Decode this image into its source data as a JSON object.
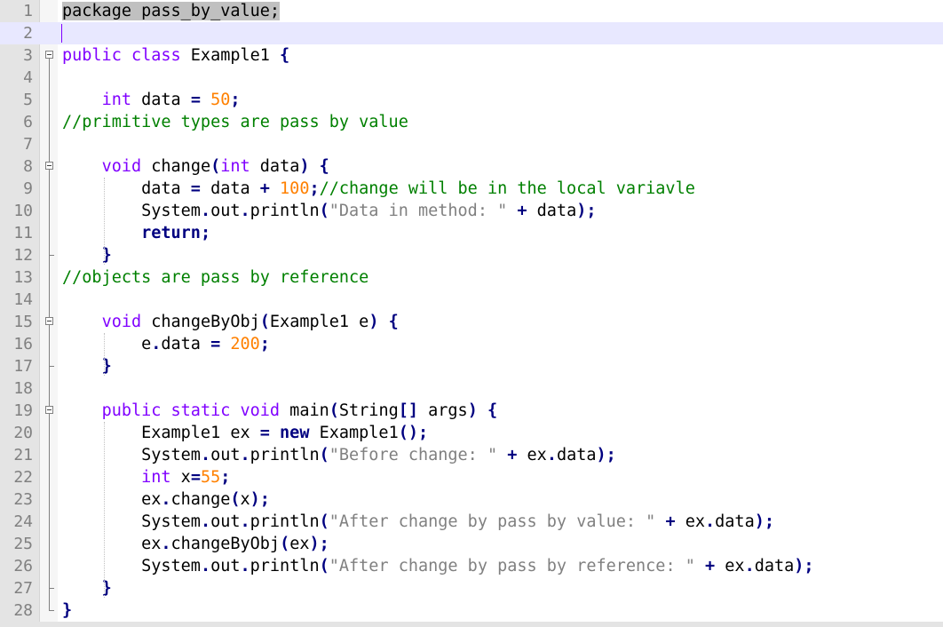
{
  "editor": {
    "current_line": 2,
    "lines": [
      {
        "number": "1",
        "tokens": [
          [
            "package pass_by_value;",
            "sel"
          ]
        ]
      },
      {
        "number": "2",
        "tokens": []
      },
      {
        "number": "3",
        "fold": "open",
        "tokens": [
          [
            "public class ",
            "kw"
          ],
          [
            "Example1 ",
            ""
          ],
          [
            "{",
            "op"
          ]
        ]
      },
      {
        "number": "4",
        "tokens": []
      },
      {
        "number": "5",
        "tokens": [
          [
            "    ",
            ""
          ],
          [
            "int",
            "kw"
          ],
          [
            " data ",
            ""
          ],
          [
            "=",
            "op"
          ],
          [
            " ",
            ""
          ],
          [
            "50",
            "num"
          ],
          [
            ";",
            "op"
          ]
        ]
      },
      {
        "number": "6",
        "tokens": [
          [
            "//primitive types are pass by value",
            "cmt"
          ]
        ]
      },
      {
        "number": "7",
        "tokens": []
      },
      {
        "number": "8",
        "fold": "open",
        "tokens": [
          [
            "    ",
            ""
          ],
          [
            "void",
            "kw"
          ],
          [
            " change",
            ""
          ],
          [
            "(",
            "op"
          ],
          [
            "int",
            "kw"
          ],
          [
            " data",
            ""
          ],
          [
            ")",
            "op"
          ],
          [
            " ",
            ""
          ],
          [
            "{",
            "op"
          ]
        ]
      },
      {
        "number": "9",
        "tokens": [
          [
            "        data ",
            ""
          ],
          [
            "=",
            "op"
          ],
          [
            " data ",
            ""
          ],
          [
            "+",
            "op"
          ],
          [
            " ",
            ""
          ],
          [
            "100",
            "num"
          ],
          [
            ";",
            "op"
          ],
          [
            "//change will be in the local variavle",
            "cmt"
          ]
        ]
      },
      {
        "number": "10",
        "tokens": [
          [
            "        System",
            ""
          ],
          [
            ".",
            "op"
          ],
          [
            "out",
            ""
          ],
          [
            ".",
            "op"
          ],
          [
            "println",
            ""
          ],
          [
            "(",
            "op"
          ],
          [
            "\"Data in method: \"",
            "str"
          ],
          [
            " ",
            ""
          ],
          [
            "+",
            "op"
          ],
          [
            " data",
            ""
          ],
          [
            ");",
            "op"
          ]
        ]
      },
      {
        "number": "11",
        "tokens": [
          [
            "        ",
            ""
          ],
          [
            "return",
            "kwb"
          ],
          [
            ";",
            "op"
          ]
        ]
      },
      {
        "number": "12",
        "fold": "end",
        "tokens": [
          [
            "    ",
            ""
          ],
          [
            "}",
            "op"
          ]
        ]
      },
      {
        "number": "13",
        "tokens": [
          [
            "//objects are pass by reference",
            "cmt"
          ]
        ]
      },
      {
        "number": "14",
        "tokens": []
      },
      {
        "number": "15",
        "fold": "open",
        "tokens": [
          [
            "    ",
            ""
          ],
          [
            "void",
            "kw"
          ],
          [
            " changeByObj",
            ""
          ],
          [
            "(",
            "op"
          ],
          [
            "Example1 e",
            ""
          ],
          [
            ")",
            "op"
          ],
          [
            " ",
            ""
          ],
          [
            "{",
            "op"
          ]
        ]
      },
      {
        "number": "16",
        "tokens": [
          [
            "        e",
            ""
          ],
          [
            ".",
            "op"
          ],
          [
            "data ",
            ""
          ],
          [
            "=",
            "op"
          ],
          [
            " ",
            ""
          ],
          [
            "200",
            "num"
          ],
          [
            ";",
            "op"
          ]
        ]
      },
      {
        "number": "17",
        "fold": "end",
        "tokens": [
          [
            "    ",
            ""
          ],
          [
            "}",
            "op"
          ]
        ]
      },
      {
        "number": "18",
        "tokens": []
      },
      {
        "number": "19",
        "fold": "open",
        "tokens": [
          [
            "    ",
            ""
          ],
          [
            "public static void",
            "kw"
          ],
          [
            " main",
            ""
          ],
          [
            "(",
            "op"
          ],
          [
            "String",
            ""
          ],
          [
            "[]",
            "op"
          ],
          [
            " args",
            ""
          ],
          [
            ")",
            "op"
          ],
          [
            " ",
            ""
          ],
          [
            "{",
            "op"
          ]
        ]
      },
      {
        "number": "20",
        "tokens": [
          [
            "        Example1 ex ",
            ""
          ],
          [
            "=",
            "op"
          ],
          [
            " ",
            ""
          ],
          [
            "new",
            "kwb"
          ],
          [
            " Example1",
            ""
          ],
          [
            "();",
            "op"
          ]
        ]
      },
      {
        "number": "21",
        "tokens": [
          [
            "        System",
            ""
          ],
          [
            ".",
            "op"
          ],
          [
            "out",
            ""
          ],
          [
            ".",
            "op"
          ],
          [
            "println",
            ""
          ],
          [
            "(",
            "op"
          ],
          [
            "\"Before change: \"",
            "str"
          ],
          [
            " ",
            ""
          ],
          [
            "+",
            "op"
          ],
          [
            " ex",
            ""
          ],
          [
            ".",
            "op"
          ],
          [
            "data",
            ""
          ],
          [
            ");",
            "op"
          ]
        ]
      },
      {
        "number": "22",
        "tokens": [
          [
            "        ",
            ""
          ],
          [
            "int",
            "kw"
          ],
          [
            " x",
            ""
          ],
          [
            "=",
            "op"
          ],
          [
            "55",
            "num"
          ],
          [
            ";",
            "op"
          ]
        ]
      },
      {
        "number": "23",
        "tokens": [
          [
            "        ex",
            ""
          ],
          [
            ".",
            "op"
          ],
          [
            "change",
            ""
          ],
          [
            "(",
            "op"
          ],
          [
            "x",
            ""
          ],
          [
            ");",
            "op"
          ]
        ]
      },
      {
        "number": "24",
        "tokens": [
          [
            "        System",
            ""
          ],
          [
            ".",
            "op"
          ],
          [
            "out",
            ""
          ],
          [
            ".",
            "op"
          ],
          [
            "println",
            ""
          ],
          [
            "(",
            "op"
          ],
          [
            "\"After change by pass by value: \"",
            "str"
          ],
          [
            " ",
            ""
          ],
          [
            "+",
            "op"
          ],
          [
            " ex",
            ""
          ],
          [
            ".",
            "op"
          ],
          [
            "data",
            ""
          ],
          [
            ");",
            "op"
          ]
        ]
      },
      {
        "number": "25",
        "tokens": [
          [
            "        ex",
            ""
          ],
          [
            ".",
            "op"
          ],
          [
            "changeByObj",
            ""
          ],
          [
            "(",
            "op"
          ],
          [
            "ex",
            ""
          ],
          [
            ");",
            "op"
          ]
        ]
      },
      {
        "number": "26",
        "tokens": [
          [
            "        System",
            ""
          ],
          [
            ".",
            "op"
          ],
          [
            "out",
            ""
          ],
          [
            ".",
            "op"
          ],
          [
            "println",
            ""
          ],
          [
            "(",
            "op"
          ],
          [
            "\"After change by pass by reference: \"",
            "str"
          ],
          [
            " ",
            ""
          ],
          [
            "+",
            "op"
          ],
          [
            " ex",
            ""
          ],
          [
            ".",
            "op"
          ],
          [
            "data",
            ""
          ],
          [
            ");",
            "op"
          ]
        ]
      },
      {
        "number": "27",
        "fold": "end",
        "tokens": [
          [
            "    ",
            ""
          ],
          [
            "}",
            "op"
          ]
        ]
      },
      {
        "number": "28",
        "fold": "end",
        "tokens": [
          [
            "}",
            "op"
          ]
        ]
      }
    ]
  },
  "colors": {
    "keyword": "#8000ff",
    "operator": "#000080",
    "number": "#ff8000",
    "string": "#808080",
    "comment": "#008000",
    "current_line_highlight": "#e8e8ff",
    "selection": "#c0c0c0"
  }
}
